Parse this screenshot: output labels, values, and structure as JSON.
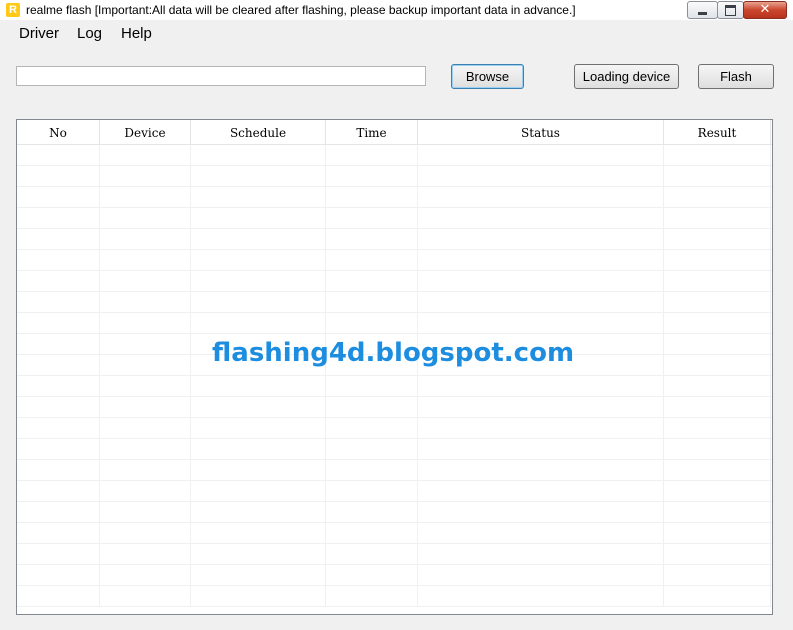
{
  "window": {
    "title": "realme flash [Important:All data will be cleared after flashing, please backup important data in advance.]",
    "icon_glyph": "R",
    "icon_color": "#ffc915",
    "minimize_glyph": "",
    "close_glyph": "✕"
  },
  "menu": {
    "items": [
      {
        "label": "Driver"
      },
      {
        "label": "Log"
      },
      {
        "label": "Help"
      }
    ]
  },
  "toolbar": {
    "path_value": "",
    "browse_label": "Browse",
    "load_label": "Loading device",
    "flash_label": "Flash"
  },
  "table": {
    "columns": [
      "No",
      "Device",
      "Schedule",
      "Time",
      "Status",
      "Result"
    ],
    "rows": []
  },
  "watermark": {
    "text": "flashing4d.blogspot.com",
    "color": "#1d8de0"
  }
}
